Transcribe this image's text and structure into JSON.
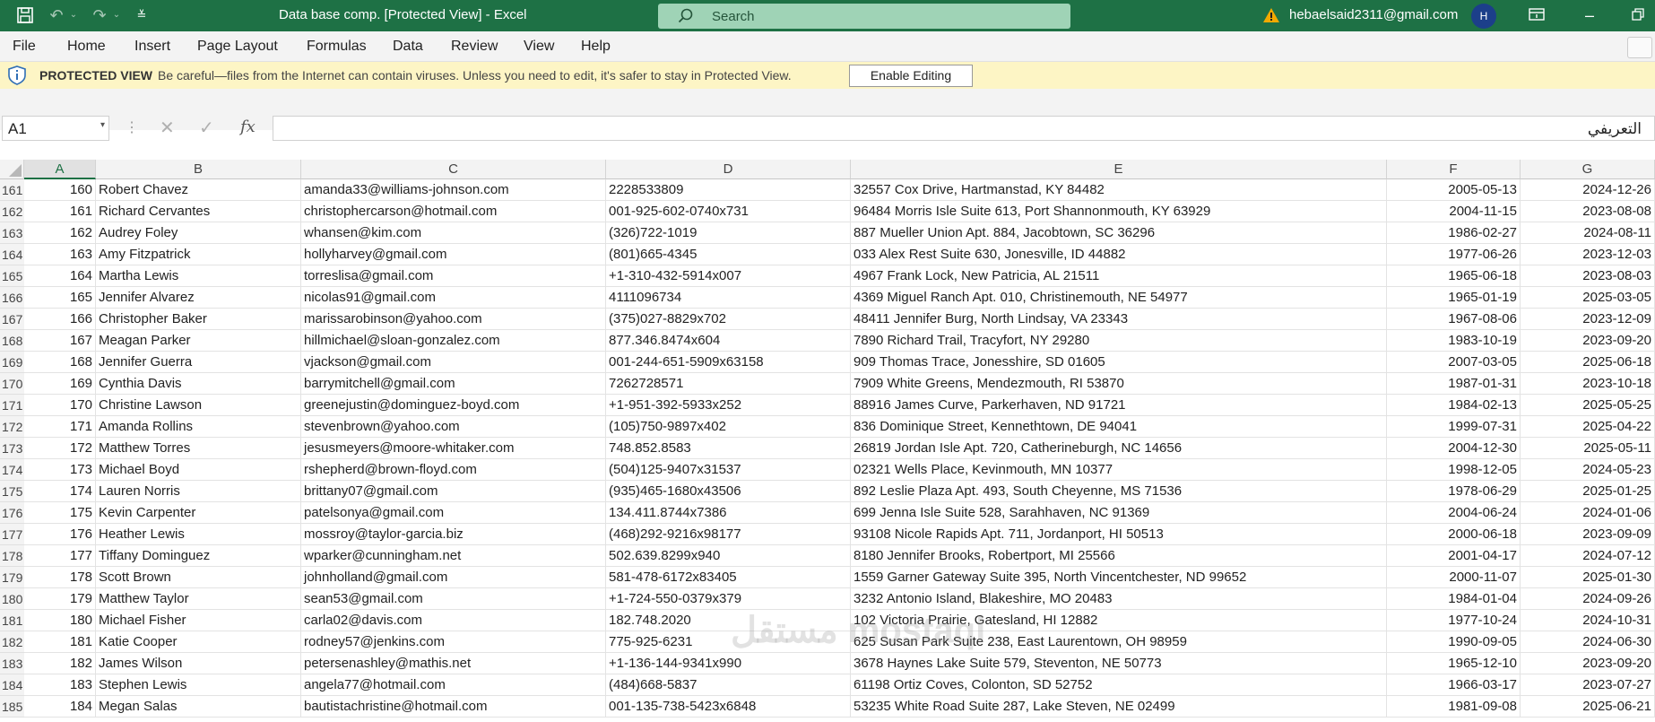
{
  "app": {
    "title": "Data base comp.  [Protected View]  -  Excel",
    "search_placeholder": "Search",
    "account_email": "hebaelsaid2311@gmail.com",
    "avatar_initial": "H"
  },
  "menu": {
    "items": [
      "File",
      "Home",
      "Insert",
      "Page Layout",
      "Formulas",
      "Data",
      "Review",
      "View",
      "Help"
    ]
  },
  "protected_view": {
    "title": "PROTECTED VIEW",
    "message": "Be careful—files from the Internet can contain viruses. Unless you need to edit, it's safer to stay in Protected View.",
    "button": "Enable Editing"
  },
  "formula_bar": {
    "name_box": "A1",
    "fx": "fx",
    "content": "التعريفي"
  },
  "columns": [
    "A",
    "B",
    "C",
    "D",
    "E",
    "F",
    "G"
  ],
  "rows": [
    {
      "n": "161",
      "a": "160",
      "b": "Robert Chavez",
      "c": "amanda33@williams-johnson.com",
      "d": "2228533809",
      "e": "32557 Cox Drive, Hartmanstad, KY 84482",
      "f": "2005-05-13",
      "g": "2024-12-26"
    },
    {
      "n": "162",
      "a": "161",
      "b": "Richard Cervantes",
      "c": "christophercarson@hotmail.com",
      "d": "001-925-602-0740x731",
      "e": "96484 Morris Isle Suite 613, Port Shannonmouth, KY 63929",
      "f": "2004-11-15",
      "g": "2023-08-08"
    },
    {
      "n": "163",
      "a": "162",
      "b": "Audrey Foley",
      "c": "whansen@kim.com",
      "d": "(326)722-1019",
      "e": "887 Mueller Union Apt. 884, Jacobtown, SC 36296",
      "f": "1986-02-27",
      "g": "2024-08-11"
    },
    {
      "n": "164",
      "a": "163",
      "b": "Amy Fitzpatrick",
      "c": "hollyharvey@gmail.com",
      "d": "(801)665-4345",
      "e": "033 Alex Rest Suite 630, Jonesville, ID 44882",
      "f": "1977-06-26",
      "g": "2023-12-03"
    },
    {
      "n": "165",
      "a": "164",
      "b": "Martha Lewis",
      "c": "torreslisa@gmail.com",
      "d": "+1-310-432-5914x007",
      "e": "4967 Frank Lock, New Patricia, AL 21511",
      "f": "1965-06-18",
      "g": "2023-08-03"
    },
    {
      "n": "166",
      "a": "165",
      "b": "Jennifer Alvarez",
      "c": "nicolas91@gmail.com",
      "d": "4111096734",
      "e": "4369 Miguel Ranch Apt. 010, Christinemouth, NE 54977",
      "f": "1965-01-19",
      "g": "2025-03-05"
    },
    {
      "n": "167",
      "a": "166",
      "b": "Christopher Baker",
      "c": "marissarobinson@yahoo.com",
      "d": "(375)027-8829x702",
      "e": "48411 Jennifer Burg, North Lindsay, VA 23343",
      "f": "1967-08-06",
      "g": "2023-12-09"
    },
    {
      "n": "168",
      "a": "167",
      "b": "Meagan Parker",
      "c": "hillmichael@sloan-gonzalez.com",
      "d": "877.346.8474x604",
      "e": "7890 Richard Trail, Tracyfort, NY 29280",
      "f": "1983-10-19",
      "g": "2023-09-20"
    },
    {
      "n": "169",
      "a": "168",
      "b": "Jennifer Guerra",
      "c": "vjackson@gmail.com",
      "d": "001-244-651-5909x63158",
      "e": "909 Thomas Trace, Jonesshire, SD 01605",
      "f": "2007-03-05",
      "g": "2025-06-18"
    },
    {
      "n": "170",
      "a": "169",
      "b": "Cynthia Davis",
      "c": "barrymitchell@gmail.com",
      "d": "7262728571",
      "e": "7909 White Greens, Mendezmouth, RI 53870",
      "f": "1987-01-31",
      "g": "2023-10-18"
    },
    {
      "n": "171",
      "a": "170",
      "b": "Christine Lawson",
      "c": "greenejustin@dominguez-boyd.com",
      "d": "+1-951-392-5933x252",
      "e": "88916 James Curve, Parkerhaven, ND 91721",
      "f": "1984-02-13",
      "g": "2025-05-25"
    },
    {
      "n": "172",
      "a": "171",
      "b": "Amanda Rollins",
      "c": "stevenbrown@yahoo.com",
      "d": "(105)750-9897x402",
      "e": "836 Dominique Street, Kennethtown, DE 94041",
      "f": "1999-07-31",
      "g": "2025-04-22"
    },
    {
      "n": "173",
      "a": "172",
      "b": "Matthew Torres",
      "c": "jesusmeyers@moore-whitaker.com",
      "d": "748.852.8583",
      "e": "26819 Jordan Isle Apt. 720, Catherineburgh, NC 14656",
      "f": "2004-12-30",
      "g": "2025-05-11"
    },
    {
      "n": "174",
      "a": "173",
      "b": "Michael Boyd",
      "c": "rshepherd@brown-floyd.com",
      "d": "(504)125-9407x31537",
      "e": "02321 Wells Place, Kevinmouth, MN 10377",
      "f": "1998-12-05",
      "g": "2024-05-23"
    },
    {
      "n": "175",
      "a": "174",
      "b": "Lauren Norris",
      "c": "brittany07@gmail.com",
      "d": "(935)465-1680x43506",
      "e": "892 Leslie Plaza Apt. 493, South Cheyenne, MS 71536",
      "f": "1978-06-29",
      "g": "2025-01-25"
    },
    {
      "n": "176",
      "a": "175",
      "b": "Kevin Carpenter",
      "c": "patelsonya@gmail.com",
      "d": "134.411.8744x7386",
      "e": "699 Jenna Isle Suite 528, Sarahhaven, NC 91369",
      "f": "2004-06-24",
      "g": "2024-01-06"
    },
    {
      "n": "177",
      "a": "176",
      "b": "Heather Lewis",
      "c": "mossroy@taylor-garcia.biz",
      "d": "(468)292-9216x98177",
      "e": "93108 Nicole Rapids Apt. 711, Jordanport, HI 50513",
      "f": "2000-06-18",
      "g": "2023-09-09"
    },
    {
      "n": "178",
      "a": "177",
      "b": "Tiffany Dominguez",
      "c": "wparker@cunningham.net",
      "d": "502.639.8299x940",
      "e": "8180 Jennifer Brooks, Robertport, MI 25566",
      "f": "2001-04-17",
      "g": "2024-07-12"
    },
    {
      "n": "179",
      "a": "178",
      "b": "Scott Brown",
      "c": "johnholland@gmail.com",
      "d": "581-478-6172x83405",
      "e": "1559 Garner Gateway Suite 395, North Vincentchester, ND 99652",
      "f": "2000-11-07",
      "g": "2025-01-30"
    },
    {
      "n": "180",
      "a": "179",
      "b": "Matthew Taylor",
      "c": "sean53@gmail.com",
      "d": "+1-724-550-0379x379",
      "e": "3232 Antonio Island, Blakeshire, MO 20483",
      "f": "1984-01-04",
      "g": "2024-09-26"
    },
    {
      "n": "181",
      "a": "180",
      "b": "Michael Fisher",
      "c": "carla02@davis.com",
      "d": "182.748.2020",
      "e": "102 Victoria Prairie, Gatesland, HI 12882",
      "f": "1977-10-24",
      "g": "2024-10-31"
    },
    {
      "n": "182",
      "a": "181",
      "b": "Katie Cooper",
      "c": "rodney57@jenkins.com",
      "d": "775-925-6231",
      "e": "625 Susan Park Suite 238, East Laurentown, OH 98959",
      "f": "1990-09-05",
      "g": "2024-06-30"
    },
    {
      "n": "183",
      "a": "182",
      "b": "James Wilson",
      "c": "petersenashley@mathis.net",
      "d": "+1-136-144-9341x990",
      "e": "3678 Haynes Lake Suite 579, Steventon, NE 50773",
      "f": "1965-12-10",
      "g": "2023-09-20"
    },
    {
      "n": "184",
      "a": "183",
      "b": "Stephen Lewis",
      "c": "angela77@hotmail.com",
      "d": "(484)668-5837",
      "e": "61198 Ortiz Coves, Colonton, SD 52752",
      "f": "1966-03-17",
      "g": "2023-07-27"
    },
    {
      "n": "185",
      "a": "184",
      "b": "Megan Salas",
      "c": "bautistachristine@hotmail.com",
      "d": "001-135-738-5423x6848",
      "e": "53235 White Road Suite 287, Lake Steven, NE 02499",
      "f": "1981-09-08",
      "g": "2025-06-21"
    }
  ],
  "watermark": "مستقل mostaql"
}
